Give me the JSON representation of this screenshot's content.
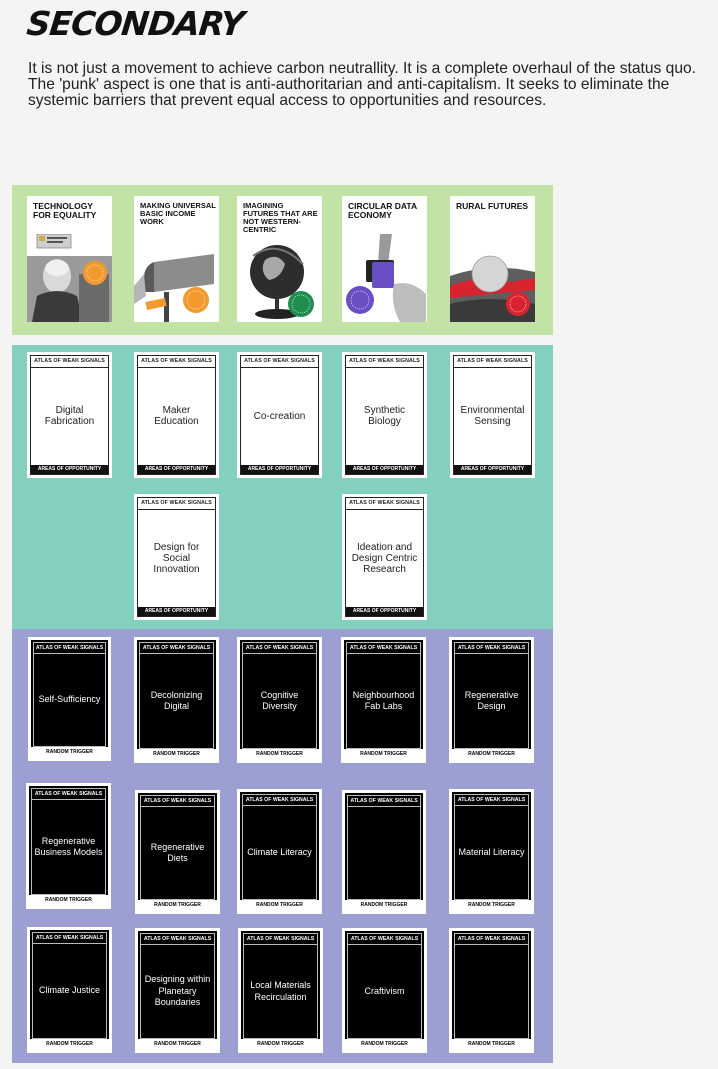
{
  "title": "SECONDARY",
  "intro": "It is not just a movement to achieve carbon neutrallity. It is a complete overhaul of the status quo. The 'punk' aspect is one that is anti-authoritarian and anti-capitalism. It seeks to eliminate the systemic barriers that prevent equal access to opportunities and resources.",
  "colors": {
    "green_band": "#c3e2a6",
    "teal_band": "#83d0bf",
    "purple_band": "#9b9fd2"
  },
  "futures": [
    {
      "title": "TECHNOLOGY FOR EQUALITY",
      "art": "elderly-person-with-laptop-image"
    },
    {
      "title": "MAKING UNIVERSAL BASIC INCOME WORK",
      "art": "mailbox-image"
    },
    {
      "title": "IMAGINING FUTURES THAT ARE NOT WESTERN-CENTRIC",
      "art": "globe-image"
    },
    {
      "title": "CIRCULAR DATA ECONOMY",
      "art": "hands-exchanging-device-image"
    },
    {
      "title": "RURAL FUTURES",
      "art": "landscape-with-sphere-image"
    }
  ],
  "opportunities": {
    "header": "ATLAS OF WEAK SIGNALS",
    "footer": "AREAS OF OPPORTUNITY",
    "cards": [
      "Digital Fabrication",
      "Maker Education",
      "Co-creation",
      "Synthetic Biology",
      "Environmental Sensing",
      "Design for Social Innovation",
      "Ideation and Design Centric Research"
    ]
  },
  "triggers": {
    "header": "ATLAS OF WEAK SIGNALS",
    "footer": "RANDOM TRIGGER",
    "cards": [
      "Self-Sufficiency",
      "Decolonizing Digital",
      "Cognitive Diversity",
      "Neighbourhood Fab Labs",
      "Regenerative Design",
      "Regenerative Business Models",
      "Regenerative Diets",
      "Climate Literacy",
      "",
      "Material Literacy",
      "Climate Justice",
      "Designing within Planetary Boundaries",
      "Local Materials Recirculation",
      "Craftivism",
      ""
    ]
  }
}
